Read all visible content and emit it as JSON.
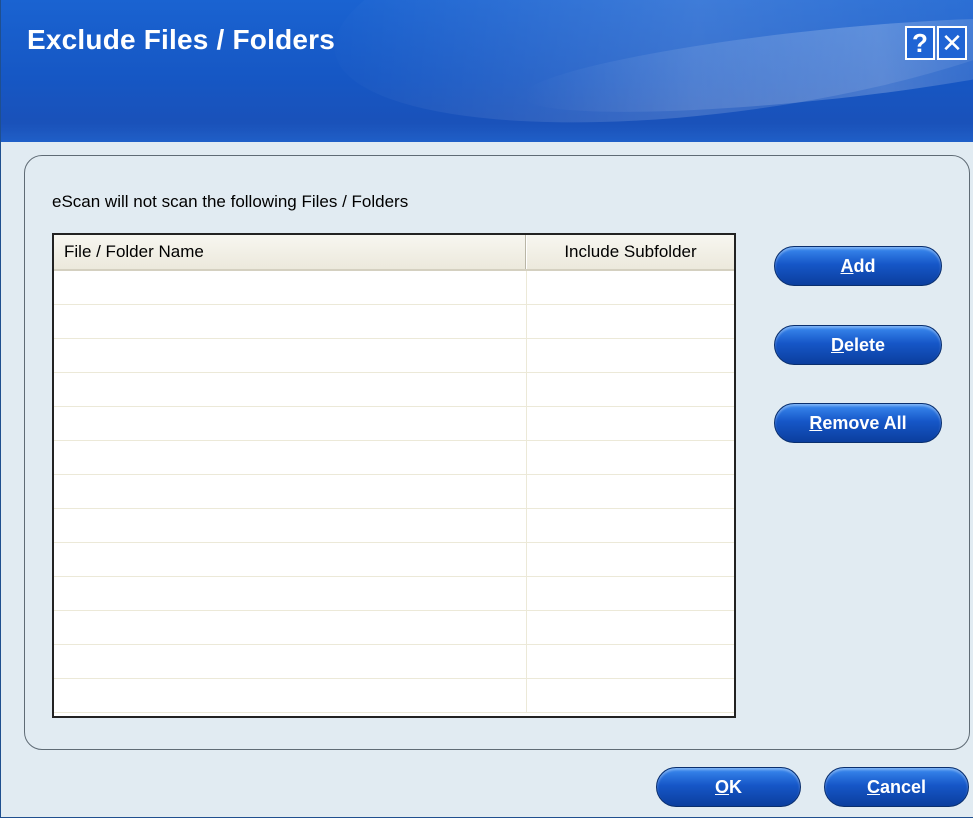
{
  "dialog": {
    "title": "Exclude Files / Folders",
    "help_glyph": "?",
    "close_glyph": "✕"
  },
  "group": {
    "caption": "eScan will not scan the following Files / Folders"
  },
  "list": {
    "columns": [
      {
        "label": "File / Folder Name"
      },
      {
        "label": "Include Subfolder"
      }
    ],
    "rows": []
  },
  "buttons": {
    "add": {
      "mnemonic": "A",
      "rest": "dd"
    },
    "delete": {
      "mnemonic": "D",
      "rest": "elete"
    },
    "remove_all": {
      "mnemonic": "R",
      "rest": "emove All"
    },
    "ok": {
      "mnemonic": "O",
      "rest": "K"
    },
    "cancel": {
      "mnemonic": "C",
      "rest": "ancel"
    }
  },
  "colors": {
    "title_bar": "#1a63d1",
    "button_blue": "#1657c8",
    "dialog_background": "#e1ebf2"
  }
}
